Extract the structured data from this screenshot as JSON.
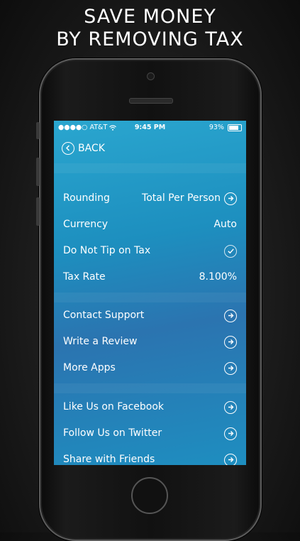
{
  "headline": {
    "line1": "SAVE MONEY",
    "line2": "BY REMOVING TAX"
  },
  "status_bar": {
    "signal": "●●●●○",
    "carrier": "AT&T",
    "wifi_icon": "wifi-icon",
    "time": "9:45 PM",
    "battery_percent": "93%",
    "battery_level": 0.93
  },
  "nav": {
    "back_label": "BACK"
  },
  "settings": {
    "group1": [
      {
        "label": "Rounding",
        "value": "Total Per Person",
        "icon": "chevron-circle-right-icon"
      },
      {
        "label": "Currency",
        "value": "Auto",
        "icon": ""
      },
      {
        "label": "Do Not Tip on Tax",
        "value": "",
        "icon": "checkmark-circle-icon",
        "checked": true
      },
      {
        "label": "Tax Rate",
        "value": "8.100%",
        "icon": ""
      }
    ],
    "group2": [
      {
        "label": "Contact Support",
        "icon": "chevron-circle-right-icon"
      },
      {
        "label": "Write a Review",
        "icon": "chevron-circle-right-icon"
      },
      {
        "label": "More Apps",
        "icon": "chevron-circle-right-icon"
      }
    ],
    "group3": [
      {
        "label": "Like Us on Facebook",
        "icon": "chevron-circle-right-icon"
      },
      {
        "label": "Follow Us on Twitter",
        "icon": "chevron-circle-right-icon"
      },
      {
        "label": "Share with Friends",
        "icon": "chevron-circle-right-icon"
      }
    ]
  },
  "colors": {
    "screen_accent": "#1d8fbf",
    "text": "#ffffff"
  }
}
